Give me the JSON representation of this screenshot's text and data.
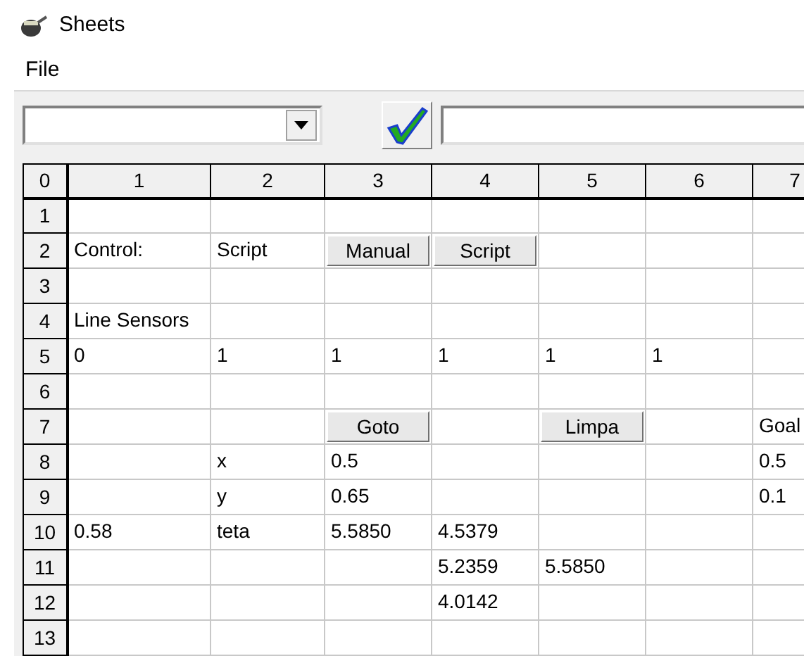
{
  "window": {
    "title": "Sheets"
  },
  "menu": [
    "File"
  ],
  "sheet": {
    "corner": "0",
    "columns": [
      "1",
      "2",
      "3",
      "4",
      "5",
      "6",
      "7"
    ],
    "rows": [
      {
        "header": "1",
        "cells": [
          {
            "kind": "blank"
          },
          {
            "kind": "blank"
          },
          {
            "kind": "blank"
          },
          {
            "kind": "blank"
          },
          {
            "kind": "blank"
          },
          {
            "kind": "blank"
          },
          {
            "kind": "blank"
          }
        ]
      },
      {
        "header": "2",
        "cells": [
          {
            "kind": "text",
            "text": "Control:"
          },
          {
            "kind": "text",
            "text": "Script"
          },
          {
            "kind": "button",
            "text": "Manual"
          },
          {
            "kind": "button",
            "text": "Script"
          },
          {
            "kind": "blank"
          },
          {
            "kind": "blank"
          },
          {
            "kind": "blank"
          }
        ]
      },
      {
        "header": "3",
        "cells": [
          {
            "kind": "blank"
          },
          {
            "kind": "blank"
          },
          {
            "kind": "blank"
          },
          {
            "kind": "blank"
          },
          {
            "kind": "blank"
          },
          {
            "kind": "blank"
          },
          {
            "kind": "blank"
          }
        ]
      },
      {
        "header": "4",
        "cells": [
          {
            "kind": "text",
            "text": "Line Sensors"
          },
          {
            "kind": "blank"
          },
          {
            "kind": "blank"
          },
          {
            "kind": "blank"
          },
          {
            "kind": "blank"
          },
          {
            "kind": "blank"
          },
          {
            "kind": "blank"
          }
        ]
      },
      {
        "header": "5",
        "cells": [
          {
            "kind": "text",
            "text": "0"
          },
          {
            "kind": "text",
            "text": "1"
          },
          {
            "kind": "text",
            "text": "1"
          },
          {
            "kind": "text",
            "text": "1"
          },
          {
            "kind": "text",
            "text": "1"
          },
          {
            "kind": "text",
            "text": "1"
          },
          {
            "kind": "blank"
          }
        ]
      },
      {
        "header": "6",
        "cells": [
          {
            "kind": "blank"
          },
          {
            "kind": "blank"
          },
          {
            "kind": "blank"
          },
          {
            "kind": "blank"
          },
          {
            "kind": "blank"
          },
          {
            "kind": "blank"
          },
          {
            "kind": "blank"
          }
        ]
      },
      {
        "header": "7",
        "cells": [
          {
            "kind": "blank"
          },
          {
            "kind": "blank"
          },
          {
            "kind": "button",
            "text": "Goto"
          },
          {
            "kind": "blank"
          },
          {
            "kind": "button",
            "text": "Limpa"
          },
          {
            "kind": "blank"
          },
          {
            "kind": "text",
            "text": "Goal"
          }
        ]
      },
      {
        "header": "8",
        "cells": [
          {
            "kind": "blank"
          },
          {
            "kind": "text",
            "text": "x"
          },
          {
            "kind": "text",
            "text": "0.5"
          },
          {
            "kind": "blank"
          },
          {
            "kind": "blank"
          },
          {
            "kind": "blank"
          },
          {
            "kind": "text",
            "text": "0.5"
          }
        ]
      },
      {
        "header": "9",
        "cells": [
          {
            "kind": "blank"
          },
          {
            "kind": "text",
            "text": "y"
          },
          {
            "kind": "text",
            "text": "0.65"
          },
          {
            "kind": "blank"
          },
          {
            "kind": "blank"
          },
          {
            "kind": "blank"
          },
          {
            "kind": "text",
            "text": "0.1"
          }
        ]
      },
      {
        "header": "10",
        "cells": [
          {
            "kind": "text",
            "text": "0.58"
          },
          {
            "kind": "text",
            "text": "teta"
          },
          {
            "kind": "text",
            "text": "5.5850"
          },
          {
            "kind": "text",
            "text": "4.5379"
          },
          {
            "kind": "blank"
          },
          {
            "kind": "blank"
          },
          {
            "kind": "blank"
          }
        ]
      },
      {
        "header": "11",
        "cells": [
          {
            "kind": "blank"
          },
          {
            "kind": "blank"
          },
          {
            "kind": "blank"
          },
          {
            "kind": "text",
            "text": "5.2359"
          },
          {
            "kind": "text",
            "text": "5.5850"
          },
          {
            "kind": "blank"
          },
          {
            "kind": "blank"
          }
        ]
      },
      {
        "header": "12",
        "cells": [
          {
            "kind": "blank"
          },
          {
            "kind": "blank"
          },
          {
            "kind": "blank"
          },
          {
            "kind": "text",
            "text": "4.0142"
          },
          {
            "kind": "blank"
          },
          {
            "kind": "blank"
          },
          {
            "kind": "blank"
          }
        ]
      },
      {
        "header": "13",
        "cells": [
          {
            "kind": "blank"
          },
          {
            "kind": "blank"
          },
          {
            "kind": "blank"
          },
          {
            "kind": "blank"
          },
          {
            "kind": "blank"
          },
          {
            "kind": "blank"
          },
          {
            "kind": "blank"
          }
        ]
      }
    ]
  }
}
